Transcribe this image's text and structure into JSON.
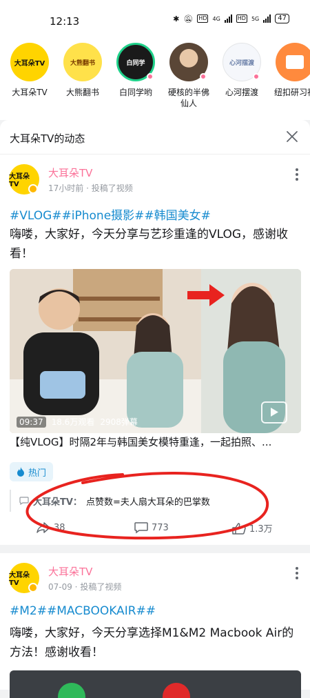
{
  "status_bar": {
    "time": "12:13",
    "network1": "4G",
    "network2": "5G",
    "hd": "HD",
    "battery": "47"
  },
  "stories": [
    {
      "name": "大耳朵TV",
      "logo_text": "大耳朵TV",
      "bg": "#ffd400",
      "dot": false
    },
    {
      "name": "大熊翻书",
      "logo_text": "大熊翻书",
      "bg": "#ffe14a",
      "dot": false
    },
    {
      "name": "白同学哟",
      "logo_text": "白同学",
      "bg": "#1a1a1a",
      "dot": true
    },
    {
      "name": "硬核的半佛仙人",
      "logo_text": "",
      "bg": "#8a6a52",
      "dot": true
    },
    {
      "name": "心河摆渡",
      "logo_text": "心河摆渡",
      "bg": "#f5f7fb",
      "dot": true
    },
    {
      "name": "纽扣研习社",
      "logo_text": "",
      "bg": "#ff8a3d",
      "dot": false
    }
  ],
  "panel": {
    "title": "大耳朵TV的动态"
  },
  "post1": {
    "uploader": "大耳朵TV",
    "avatar_text": "大耳朵TV",
    "meta": "17小时前 · 投稿了视频",
    "tags": "#VLOG##iPhone摄影##韩国美女#",
    "description": "嗨喽，大家好，今天分享与艺珍重逢的VLOG，感谢收看！",
    "video": {
      "duration": "09:37",
      "views": "18.6万观看",
      "danmaku": "2908弹幕"
    },
    "video_title": "【纯VLOG】时隔2年与韩国美女模特重逢，一起拍照、...",
    "hot_label": "热门",
    "comment_user": "大耳朵TV：",
    "comment_text": "点赞数=夫人扇大耳朵的巴掌数",
    "shares": "38",
    "comments": "773",
    "likes": "1.3万"
  },
  "post2": {
    "uploader": "大耳朵TV",
    "avatar_text": "大耳朵TV",
    "meta": "07-09 · 投稿了视频",
    "tags": "#M2##MACBOOKAIR##",
    "description": "嗨喽，大家好，今天分享选择M1&M2 Macbook Air的方法！感谢收看！"
  },
  "colors": {
    "brand_pink": "#fb7299",
    "link_blue": "#178bcf",
    "annotation_red": "#e8231f"
  }
}
